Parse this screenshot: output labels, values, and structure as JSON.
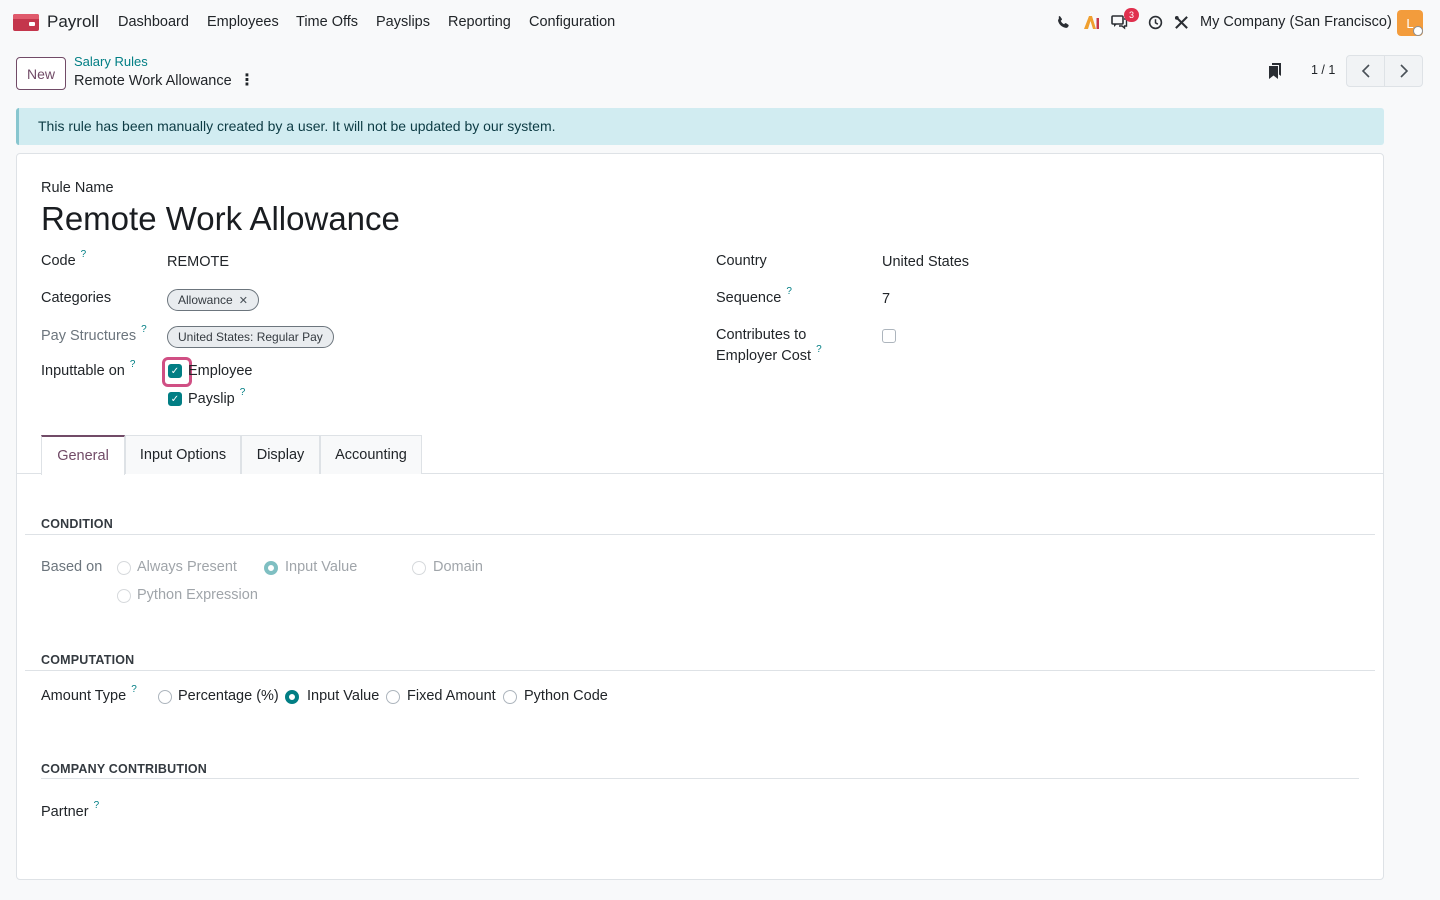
{
  "navbar": {
    "brand": "Payroll",
    "menu": [
      "Dashboard",
      "Employees",
      "Time Offs",
      "Payslips",
      "Reporting",
      "Configuration"
    ],
    "messages_badge": "3",
    "company": "My Company (San Francisco)",
    "avatar_letter": "L"
  },
  "control_panel": {
    "new_button": "New",
    "breadcrumb": "Salary Rules",
    "record_title": "Remote Work Allowance",
    "pager": "1 / 1"
  },
  "alert": {
    "text": "This rule has been manually created by a user. It will not be updated by our system."
  },
  "form": {
    "rule_name_label": "Rule Name",
    "rule_name": "Remote Work Allowance",
    "code_label": "Code",
    "code": "REMOTE",
    "categories_label": "Categories",
    "category_tag": "Allowance",
    "pay_structures_label": "Pay Structures",
    "pay_structure_tag": "United States: Regular Pay",
    "inputtable_label": "Inputtable on",
    "inputtable_employee": "Employee",
    "inputtable_payslip": "Payslip",
    "country_label": "Country",
    "country": "United States",
    "sequence_label": "Sequence",
    "sequence": "7",
    "contributes_label_1": "Contributes to",
    "contributes_label_2": "Employer Cost",
    "help_mark": "?"
  },
  "tabs": [
    "General",
    "Input Options",
    "Display",
    "Accounting"
  ],
  "condition": {
    "title": "CONDITION",
    "based_on_label": "Based on",
    "options": [
      "Always Present",
      "Input Value",
      "Domain",
      "Python Expression"
    ],
    "selected": "Input Value"
  },
  "computation": {
    "title": "COMPUTATION",
    "amount_type_label": "Amount Type",
    "options": [
      "Percentage (%)",
      "Input Value",
      "Fixed Amount",
      "Python Code"
    ],
    "selected": "Input Value"
  },
  "company_contribution": {
    "title": "COMPANY CONTRIBUTION",
    "partner_label": "Partner"
  },
  "colors": {
    "brand_purple": "#714b67",
    "accent_teal": "#017e84",
    "alert_bg": "#d1ecf1",
    "badge_red": "#e0304e",
    "avatar_orange": "#f39c3c"
  }
}
